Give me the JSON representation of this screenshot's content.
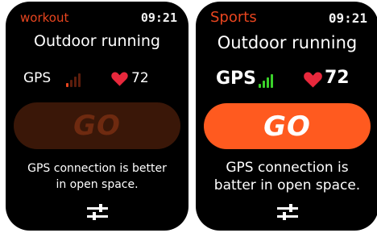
{
  "screens": [
    {
      "app_name": "workout",
      "time": "09:21",
      "title": "Outdoor running",
      "gps_label": "GPS",
      "gps_signal_bars_active": 1,
      "gps_signal_bars_total": 4,
      "heart_rate": "72",
      "go_label": "GO",
      "hint_line1": "GPS connection is better",
      "hint_line2": "in open space."
    },
    {
      "app_name": "Sports",
      "time": "09:21",
      "title": "Outdoor running",
      "gps_label": "GPS",
      "gps_signal_bars_active": 4,
      "gps_signal_bars_total": 4,
      "heart_rate": "72",
      "go_label": "GO",
      "hint_line1": "GPS connection is",
      "hint_line2": "batter in open space."
    }
  ],
  "colors": {
    "accent": "#e8451f",
    "go_active": "#ff5a1f",
    "go_inactive": "#3a1708",
    "heart": "#e8283c",
    "signal_good": "#3ad12a"
  },
  "icons": {
    "heart": "heart-icon",
    "signal": "gps-signal-icon",
    "settings": "sliders-icon"
  }
}
